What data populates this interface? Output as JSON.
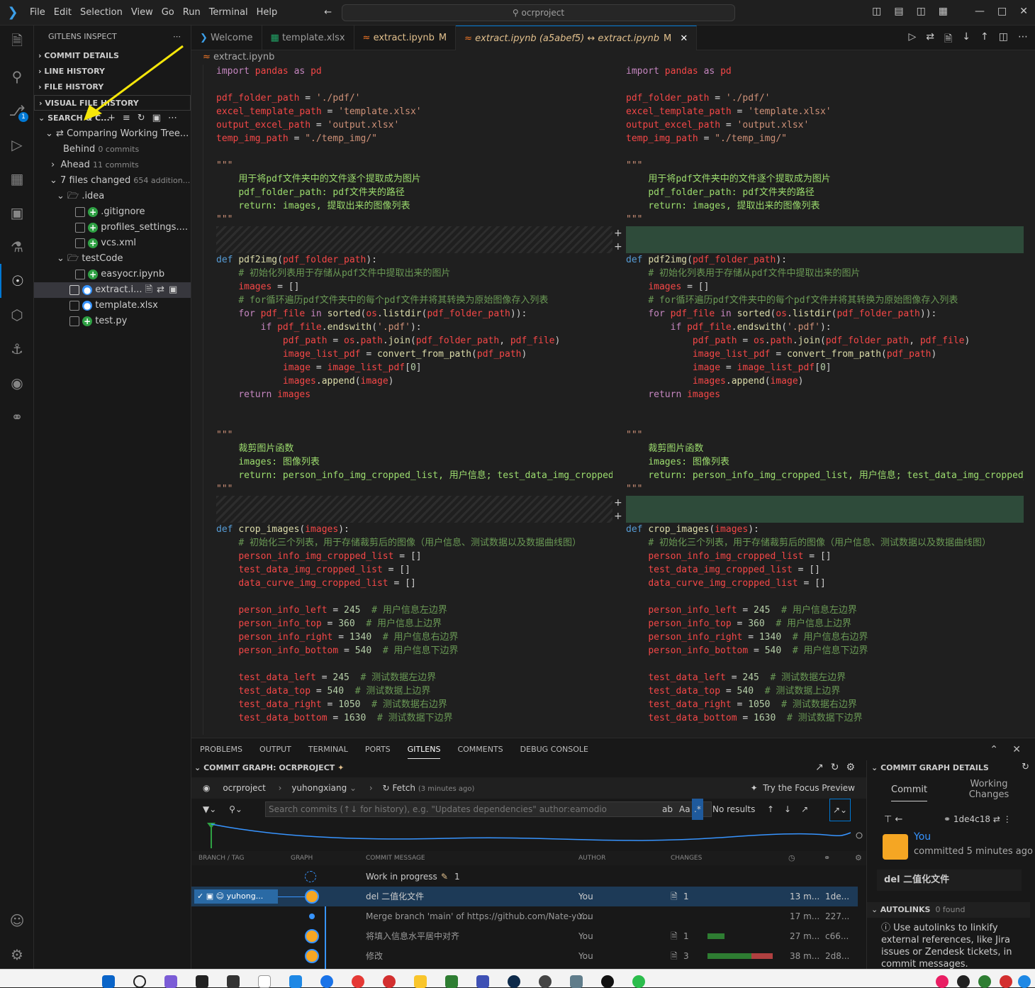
{
  "titlebar": {
    "menus": [
      "File",
      "Edit",
      "Selection",
      "View",
      "Go",
      "Run",
      "Terminal",
      "Help"
    ],
    "search": "ocrproject"
  },
  "sidebar": {
    "title": "GITLENS INSPECT",
    "sections": [
      "COMMIT DETAILS",
      "LINE HISTORY",
      "FILE HISTORY",
      "VISUAL FILE HISTORY",
      "SEARCH & C..."
    ],
    "compare": "Comparing Working Tree...",
    "behind": "Behind",
    "behind_count": "0 commits",
    "ahead": "Ahead",
    "ahead_count": "11 commits",
    "changed": "7 files changed",
    "changed_detail": "654 addition...",
    "folder1": ".idea",
    "f1": ".gitignore",
    "f2": "profiles_settings....",
    "f3": "vcs.xml",
    "folder2": "testCode",
    "f4": "easyocr.ipynb",
    "f5": "extract.i...",
    "f6": "template.xlsx",
    "f7": "test.py",
    "badge": "1"
  },
  "tabs": [
    {
      "label": "Welcome"
    },
    {
      "label": "template.xlsx"
    },
    {
      "label": "extract.ipynb",
      "mod": "M"
    },
    {
      "label": "extract.ipynb (a5abef5) ↔ extract.ipynb",
      "mod": "M"
    }
  ],
  "breadcrumb": "extract.ipynb",
  "panel": {
    "tabs": [
      "PROBLEMS",
      "OUTPUT",
      "TERMINAL",
      "PORTS",
      "GITLENS",
      "COMMENTS",
      "DEBUG CONSOLE"
    ]
  },
  "graph": {
    "title": "COMMIT GRAPH: OCRPROJECT",
    "repo": "ocrproject",
    "branch": "yuhongxiang",
    "fetch": "Fetch",
    "fetch_time": "(3 minutes ago)",
    "focus": "Try the Focus Preview",
    "search_placeholder": "Search commits (↑↓ for history), e.g. \"Updates dependencies\" author:eamodio",
    "no_results": "No results",
    "cols": [
      "BRANCH / TAG",
      "GRAPH",
      "COMMIT MESSAGE",
      "AUTHOR",
      "CHANGES"
    ],
    "branch_tag": "yuhong...",
    "wip": "Work in progress",
    "wip_count": "1",
    "rows": [
      {
        "msg": "del 二值化文件",
        "author": "You",
        "changes": "1",
        "time": "13 m...",
        "sha": "1de..."
      },
      {
        "msg": "Merge branch 'main' of https://github.com/Nate-yu...",
        "author": "You",
        "changes": "",
        "time": "17 m...",
        "sha": "227..."
      },
      {
        "msg": "将填入信息水平居中对齐",
        "author": "You",
        "changes": "1",
        "time": "27 m...",
        "sha": "c66..."
      },
      {
        "msg": "修改",
        "author": "You",
        "changes": "3",
        "time": "38 m...",
        "sha": "2d8..."
      }
    ]
  },
  "details": {
    "title": "COMMIT GRAPH DETAILS",
    "tab1": "Commit",
    "tab2": "Working Changes",
    "sha": "1de4c18",
    "author": "You",
    "committed": "committed 5 minutes ago",
    "message": "del 二值化文件",
    "autolinks": "AUTOLINKS",
    "autolinks_found": "0 found",
    "autolinks_text": "Use autolinks to linkify external references, like Jira issues or Zendesk tickets, in commit messages."
  }
}
